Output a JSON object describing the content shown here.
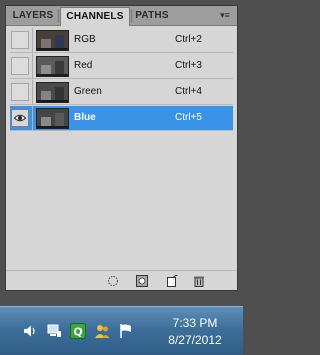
{
  "tabs": [
    {
      "label": "LAYERS",
      "active": false
    },
    {
      "label": "CHANNELS",
      "active": true
    },
    {
      "label": "PATHS",
      "active": false
    }
  ],
  "channels": [
    {
      "name": "RGB",
      "shortcut": "Ctrl+2",
      "visible": false,
      "selected": false
    },
    {
      "name": "Red",
      "shortcut": "Ctrl+3",
      "visible": false,
      "selected": false
    },
    {
      "name": "Green",
      "shortcut": "Ctrl+4",
      "visible": false,
      "selected": false
    },
    {
      "name": "Blue",
      "shortcut": "Ctrl+5",
      "visible": true,
      "selected": true
    }
  ],
  "bottom_icons": [
    "load-selection-icon",
    "save-selection-icon",
    "new-channel-icon",
    "trash-icon"
  ],
  "tray_icons": [
    "speaker-icon",
    "network-icon",
    "quicken-icon",
    "people-icon",
    "action-center-flag-icon"
  ],
  "clock": {
    "time": "7:33 PM",
    "date": "8/27/2012"
  },
  "colors": {
    "selection": "#3b93e8",
    "panel": "#d6d6d6",
    "taskbar": "#3d6f9b"
  }
}
